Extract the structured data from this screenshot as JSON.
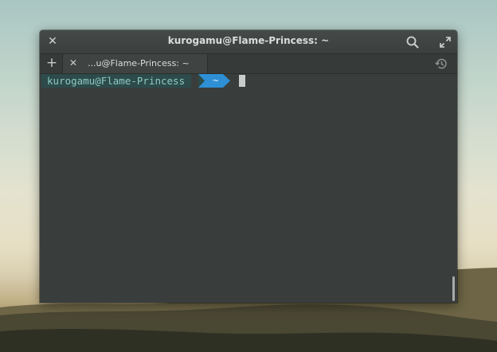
{
  "window": {
    "title": "kurogamu@Flame-Princess: ~"
  },
  "tabs": [
    {
      "label": "...u@Flame-Princess: ~"
    }
  ],
  "terminal": {
    "prompt_user": "kurogamu@Flame-Princess",
    "prompt_dir": "~"
  },
  "colors": {
    "window_bg": "#393e3d",
    "prompt_user_bg": "#2c4b4a",
    "prompt_user_fg": "#8fc9c3",
    "prompt_dir_bg": "#2e8fd4"
  },
  "icons": {
    "close": "close-icon",
    "search": "search-icon",
    "maximize": "maximize-icon",
    "new_tab": "plus-icon",
    "tab_close": "close-icon",
    "history": "history-icon"
  }
}
